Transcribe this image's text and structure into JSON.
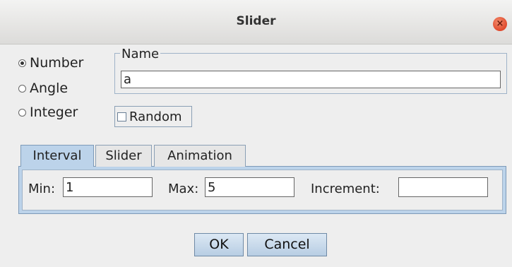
{
  "window": {
    "title": "Slider",
    "close_label": "×"
  },
  "type_options": [
    {
      "label": "Number",
      "selected": true
    },
    {
      "label": "Angle",
      "selected": false
    },
    {
      "label": "Integer",
      "selected": false
    }
  ],
  "name_group": {
    "legend": "Name",
    "value": "a"
  },
  "random": {
    "label": "Random",
    "checked": false
  },
  "tabs": [
    {
      "label": "Interval",
      "active": true
    },
    {
      "label": "Slider",
      "active": false
    },
    {
      "label": "Animation",
      "active": false
    }
  ],
  "interval": {
    "min_label": "Min:",
    "min_value": "1",
    "max_label": "Max:",
    "max_value": "5",
    "increment_label": "Increment:",
    "increment_value": ""
  },
  "buttons": {
    "ok": "OK",
    "cancel": "Cancel"
  }
}
